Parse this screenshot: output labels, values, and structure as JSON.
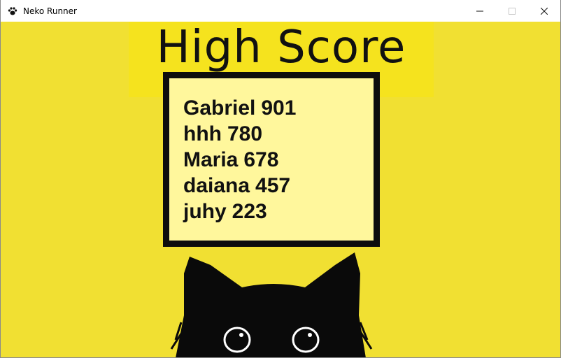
{
  "window": {
    "title": "Neko Runner",
    "icon": "paw-icon",
    "controls": [
      "minimize-icon",
      "maximize-icon",
      "close-icon"
    ]
  },
  "game": {
    "heading": "High Score",
    "scores": [
      {
        "name": "Gabriel",
        "score": "901"
      },
      {
        "name": "hhh",
        "score": "780"
      },
      {
        "name": "Maria",
        "score": "678"
      },
      {
        "name": "daiana",
        "score": "457"
      },
      {
        "name": "juhy",
        "score": "223"
      }
    ]
  },
  "colors": {
    "background": "#f1e032",
    "banner": "#f5e31e",
    "board": "#fff79c",
    "border": "#0d0d0d"
  }
}
